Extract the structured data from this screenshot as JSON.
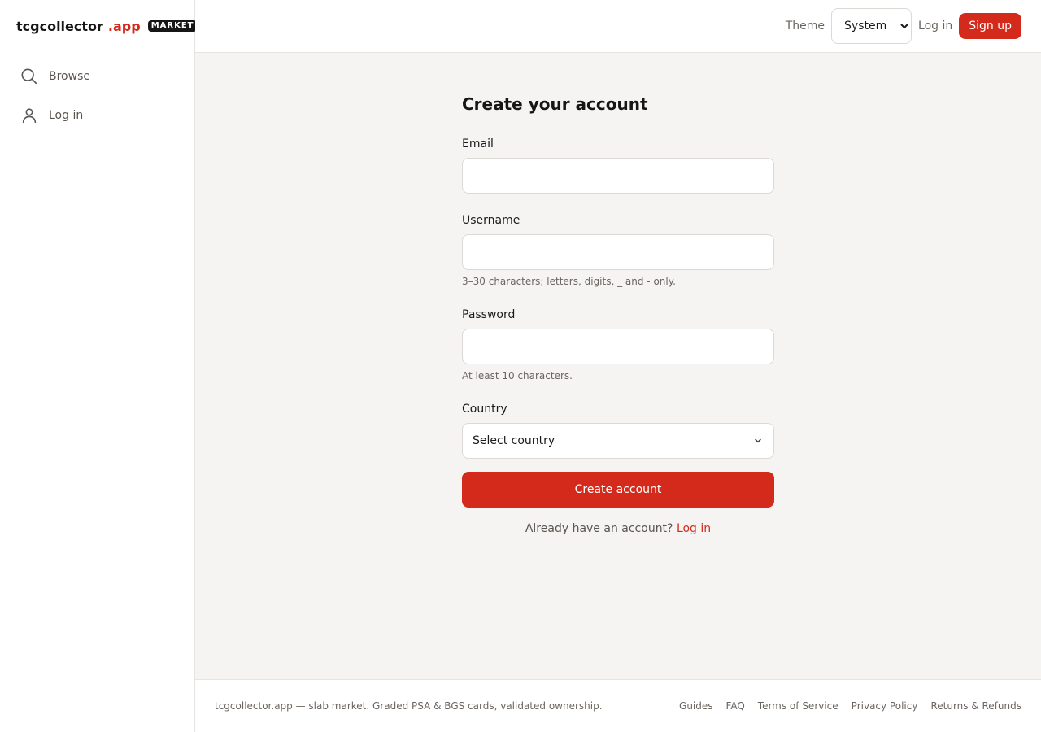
{
  "brand": {
    "name": "tcgcollector",
    "tld": ".app",
    "badge": "MARKET"
  },
  "sidebar": {
    "items": [
      {
        "label": "Browse",
        "icon": "search-icon"
      },
      {
        "label": "Log in",
        "icon": "user-icon"
      }
    ]
  },
  "topbar": {
    "theme_label": "Theme",
    "theme_value": "System",
    "login": "Log in",
    "signup": "Sign up"
  },
  "form": {
    "title": "Create your account",
    "email": {
      "label": "Email",
      "value": "",
      "placeholder": ""
    },
    "username": {
      "label": "Username",
      "value": "",
      "placeholder": "",
      "hint": "3–30 characters; letters, digits, _ and - only."
    },
    "password": {
      "label": "Password",
      "value": "",
      "placeholder": "",
      "hint": "At least 10 characters."
    },
    "country": {
      "label": "Country",
      "value": "Select country"
    },
    "submit": "Create account",
    "already_text": "Already have an account?",
    "already_link": "Log in"
  },
  "footer": {
    "text": "tcgcollector.app — slab market. Graded PSA & BGS cards, validated ownership.",
    "links": [
      "Guides",
      "FAQ",
      "Terms of Service",
      "Privacy Policy",
      "Returns & Refunds"
    ]
  },
  "colors": {
    "accent": "#d42a1c",
    "text": "#1a1a1a",
    "muted": "#6b6560",
    "background": "#f5f4f2",
    "surface": "#ffffff"
  }
}
